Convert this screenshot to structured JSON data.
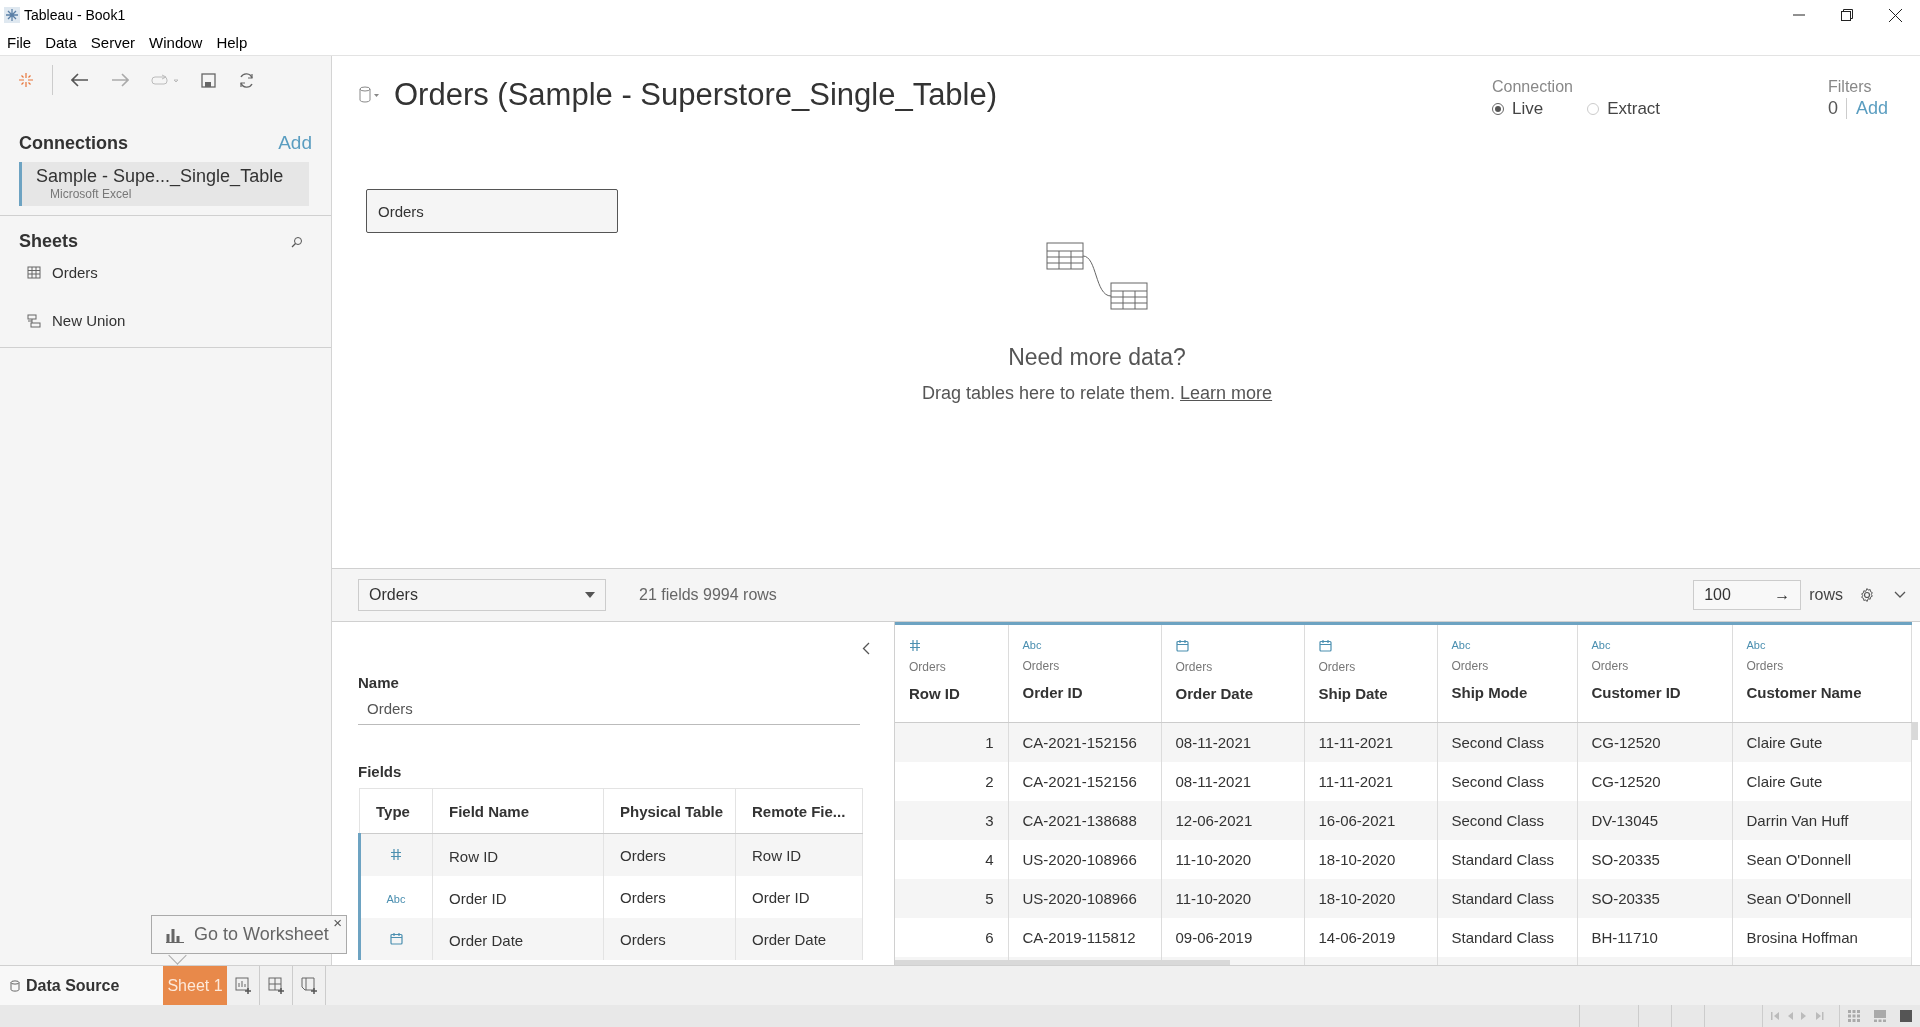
{
  "window": {
    "title": "Tableau - Book1"
  },
  "menu": [
    "File",
    "Data",
    "Server",
    "Window",
    "Help"
  ],
  "sidebar": {
    "connections_title": "Connections",
    "add": "Add",
    "connections": [
      {
        "name": "Sample - Supe..._Single_Table",
        "type": "Microsoft Excel",
        "selected": true
      }
    ],
    "sheets_title": "Sheets",
    "sheets": [
      {
        "kind": "table",
        "label": "Orders"
      },
      {
        "kind": "union",
        "label": "New Union"
      }
    ]
  },
  "datasource": {
    "title": "Orders (Sample - Superstore_Single_Table)",
    "connection_label": "Connection",
    "connection_options": [
      {
        "label": "Live",
        "selected": true
      },
      {
        "label": "Extract",
        "selected": false
      }
    ],
    "filters_label": "Filters",
    "filters_count": "0",
    "filters_add": "Add"
  },
  "canvas": {
    "tables": [
      "Orders"
    ],
    "empty_title": "Need more data?",
    "empty_text": "Drag tables here to relate them.",
    "empty_link": "Learn more"
  },
  "toolbar": {
    "table_select": "Orders",
    "summary": "21 fields 9994 rows",
    "rows_value": "100",
    "rows_arrow": "→",
    "rows_label": "rows"
  },
  "metadata": {
    "name_label": "Name",
    "name_value": "Orders",
    "fields_label": "Fields",
    "columns": [
      "Type",
      "Field Name",
      "Physical Table",
      "Remote Fie..."
    ],
    "rows": [
      {
        "kind": "number",
        "field": "Row ID",
        "table": "Orders",
        "remote": "Row ID"
      },
      {
        "kind": "string",
        "type_text": "Abc",
        "field": "Order ID",
        "table": "Orders",
        "remote": "Order ID"
      },
      {
        "kind": "date",
        "field": "Order Date",
        "table": "Orders",
        "remote": "Order Date"
      }
    ]
  },
  "grid": {
    "columns": [
      {
        "kind": "number",
        "table": "Orders",
        "name": "Row ID"
      },
      {
        "kind": "string",
        "type_text": "Abc",
        "table": "Orders",
        "name": "Order ID"
      },
      {
        "kind": "date",
        "table": "Orders",
        "name": "Order Date"
      },
      {
        "kind": "date",
        "table": "Orders",
        "name": "Ship Date"
      },
      {
        "kind": "string",
        "type_text": "Abc",
        "table": "Orders",
        "name": "Ship Mode"
      },
      {
        "kind": "string",
        "type_text": "Abc",
        "table": "Orders",
        "name": "Customer ID"
      },
      {
        "kind": "string",
        "type_text": "Abc",
        "table": "Orders",
        "name": "Customer Name"
      }
    ],
    "rows": [
      [
        "1",
        "CA-2021-152156",
        "08-11-2021",
        "11-11-2021",
        "Second Class",
        "CG-12520",
        "Claire Gute"
      ],
      [
        "2",
        "CA-2021-152156",
        "08-11-2021",
        "11-11-2021",
        "Second Class",
        "CG-12520",
        "Claire Gute"
      ],
      [
        "3",
        "CA-2021-138688",
        "12-06-2021",
        "16-06-2021",
        "Second Class",
        "DV-13045",
        "Darrin Van Huff"
      ],
      [
        "4",
        "US-2020-108966",
        "11-10-2020",
        "18-10-2020",
        "Standard Class",
        "SO-20335",
        "Sean O'Donnell"
      ],
      [
        "5",
        "US-2020-108966",
        "11-10-2020",
        "18-10-2020",
        "Standard Class",
        "SO-20335",
        "Sean O'Donnell"
      ],
      [
        "6",
        "CA-2019-115812",
        "09-06-2019",
        "14-06-2019",
        "Standard Class",
        "BH-11710",
        "Brosina Hoffman"
      ]
    ]
  },
  "tabs": [
    {
      "kind": "datasource",
      "label": "Data Source",
      "selected": true
    },
    {
      "kind": "sheet",
      "label": "Sheet 1",
      "selected": false
    }
  ],
  "tooltip": {
    "text": "Go to Worksheet",
    "close": "×"
  }
}
